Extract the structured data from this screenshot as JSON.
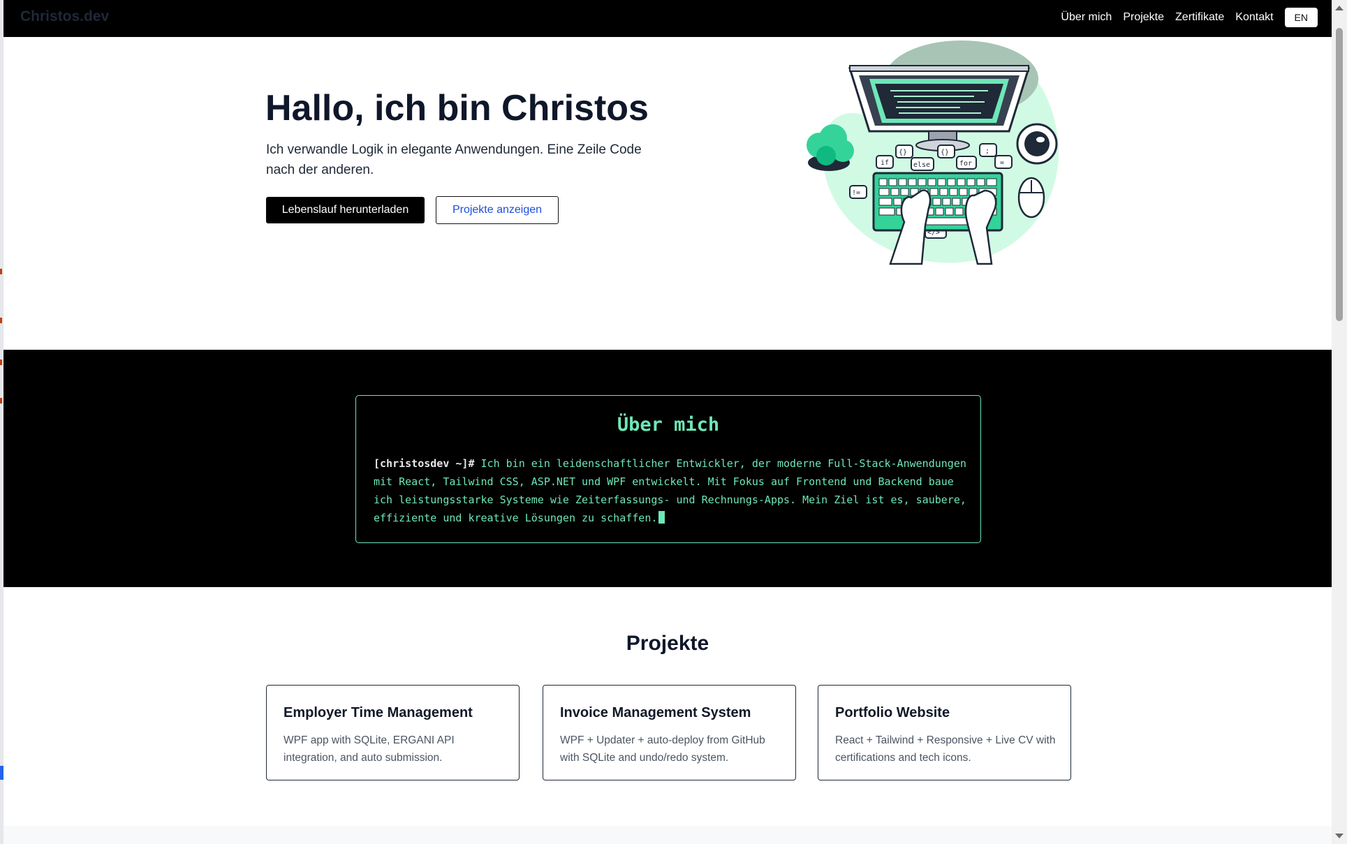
{
  "nav": {
    "brand": "Christos.dev",
    "links": [
      "Über mich",
      "Projekte",
      "Zertifikate",
      "Kontakt"
    ],
    "lang_button": "EN"
  },
  "hero": {
    "title": "Hallo, ich bin Christos",
    "subtitle": "Ich verwandle Logik in elegante Anwendungen. Eine Zeile Code nach der anderen.",
    "primary_button": "Lebenslauf herunterladen",
    "secondary_button": "Projekte anzeigen",
    "illustration_labels": [
      "if",
      "{}",
      "else",
      "{}",
      "for",
      ";",
      "=",
      "!=",
      "</>"
    ]
  },
  "about": {
    "title": "Über mich",
    "prompt": "[christosdev ~]#",
    "text": "Ich bin ein leidenschaftlicher Entwickler, der moderne Full-Stack-Anwendungen mit React, Tailwind CSS, ASP.NET und WPF entwickelt. Mit Fokus auf Frontend und Backend baue ich leistungsstarke Systeme wie Zeiterfassungs- und Rechnungs-Apps. Mein Ziel ist es, saubere, effiziente und kreative Lösungen zu schaffen."
  },
  "projects": {
    "title": "Projekte",
    "items": [
      {
        "title": "Employer Time Management",
        "description": "WPF app with SQLite, ERGANI API integration, and auto submission."
      },
      {
        "title": "Invoice Management System",
        "description": "WPF + Updater + auto-deploy from GitHub with SQLite and undo/redo system."
      },
      {
        "title": "Portfolio Website",
        "description": "React + Tailwind + Responsive + Live CV with certifications and tech icons."
      }
    ]
  },
  "colors": {
    "accent_green": "#6ee7b7",
    "terminal_bg": "#000000",
    "link_blue": "#1d4ed8"
  }
}
